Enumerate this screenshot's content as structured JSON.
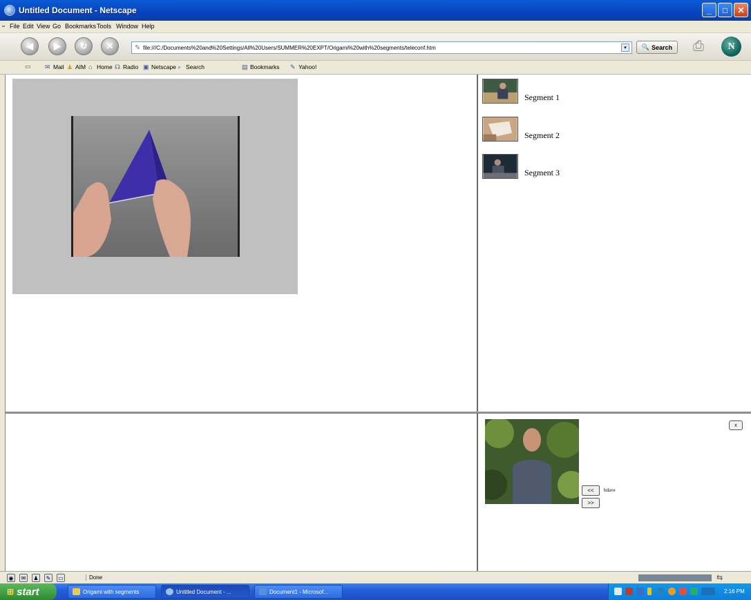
{
  "window": {
    "title": "Untitled Document - Netscape",
    "min_glyph": "_",
    "max_glyph": "□",
    "close_glyph": "✕"
  },
  "menu": {
    "items": [
      "File",
      "Edit",
      "View",
      "Go",
      "Bookmarks",
      "Tools",
      "Window",
      "Help"
    ]
  },
  "nav": {
    "back_glyph": "◀",
    "forward_glyph": "▶",
    "reload_glyph": "↻",
    "stop_glyph": "✕",
    "url": "file:///C:/Documents%20and%20Settings/All%20Users/SUMMER%20EXPT/Origami%20with%20segments/teleconf.htm",
    "search_label": "Search",
    "logo_letter": "N"
  },
  "personal": {
    "items": [
      {
        "label": "",
        "icon": "home-tab-icon"
      },
      {
        "label": "Mail",
        "icon": "mail-icon"
      },
      {
        "label": "AIM",
        "icon": "aim-icon"
      },
      {
        "label": "Home",
        "icon": "home-icon"
      },
      {
        "label": "Radio",
        "icon": "radio-icon"
      },
      {
        "label": "Netscape",
        "icon": "netscape-icon"
      },
      {
        "label": "Search",
        "icon": "search-icon"
      },
      {
        "label": "Bookmarks",
        "icon": "bookmarks-icon"
      },
      {
        "label": "Yahoo!",
        "icon": "yahoo-icon"
      }
    ]
  },
  "segments": [
    {
      "label": "Segment 1"
    },
    {
      "label": "Segment 2"
    },
    {
      "label": "Segment 3"
    }
  ],
  "controls": {
    "prev_label": "<<",
    "next_label": ">>",
    "side_label": "bdave",
    "x_label": "x"
  },
  "status": {
    "text": "Done"
  },
  "taskbar": {
    "start_label": "start",
    "tasks": [
      {
        "label": "Origami with segments"
      },
      {
        "label": "Untitled Document - ..."
      },
      {
        "label": "Document1 - Microsof..."
      }
    ],
    "clock": "2:16 PM"
  },
  "colors": {
    "titlebar": "#0a5bd6",
    "taskbar": "#245edb",
    "start": "#3c9a3c",
    "video_bg": "#c0c0c0",
    "paper": "#3e2ea8"
  }
}
